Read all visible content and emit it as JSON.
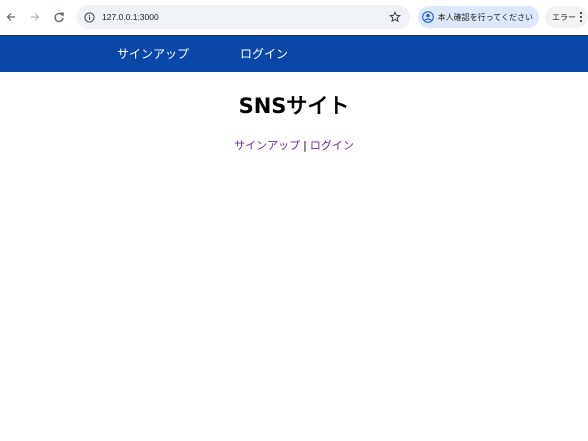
{
  "browser": {
    "url": "127.0.0.1:3000",
    "verify_chip_label": "本人確認を行ってください",
    "error_chip_label": "エラー",
    "icons": {
      "back": "arrow-left-icon",
      "forward": "arrow-right-icon",
      "reload": "reload-icon",
      "site_info": "info-circle-icon",
      "bookmark": "star-icon",
      "profile": "avatar-icon",
      "menu": "kebab-menu-icon"
    }
  },
  "site_nav": {
    "signup": "サインアップ",
    "login": "ログイン",
    "background_color": "#0948a6"
  },
  "main": {
    "title": "SNSサイト",
    "links": {
      "signup": "サインアップ",
      "separator": "|",
      "login": "ログイン"
    },
    "link_color": "#6c2d8f"
  }
}
